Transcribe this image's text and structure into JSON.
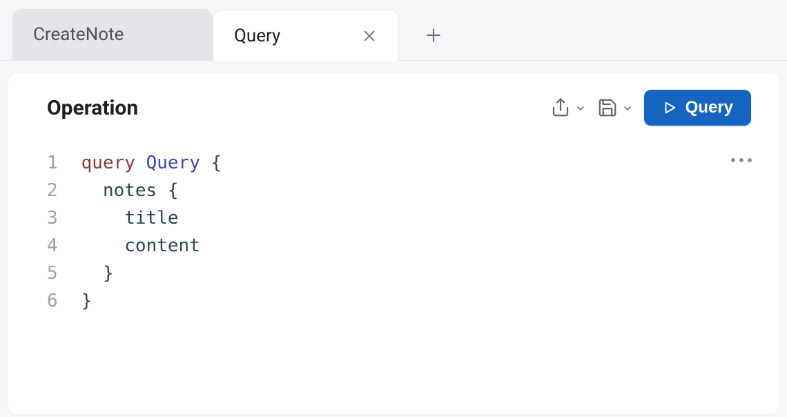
{
  "tabs": {
    "items": [
      {
        "label": "CreateNote",
        "active": false
      },
      {
        "label": "Query",
        "active": true
      }
    ]
  },
  "panel": {
    "title": "Operation"
  },
  "toolbar": {
    "export_icon": "share-icon",
    "save_icon": "save-icon",
    "run_label": "Query"
  },
  "editor": {
    "line_numbers": [
      "1",
      "2",
      "3",
      "4",
      "5",
      "6"
    ],
    "code": {
      "l1_kw": "query",
      "l1_name": "Query",
      "l1_punc": "{",
      "l2_field": "notes",
      "l2_punc": "{",
      "l3_field": "title",
      "l4_field": "content",
      "l5_punc": "}",
      "l6_punc": "}"
    }
  },
  "icons": {
    "close": "×",
    "plus": "+",
    "more": "•••"
  }
}
